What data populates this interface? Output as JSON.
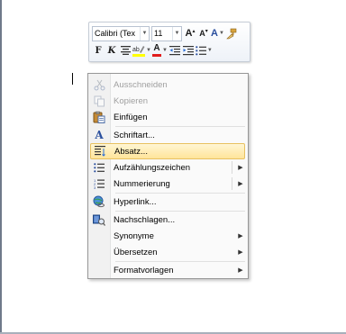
{
  "toolbar": {
    "font_name": "Calibri (Tex",
    "font_size": "11",
    "grow_font": "A",
    "shrink_font": "A",
    "styles": "A",
    "bold": "F",
    "italic": "K",
    "font_color": "A"
  },
  "menu": {
    "cut": "Ausschneiden",
    "copy": "Kopieren",
    "paste": "Einfügen",
    "font": "Schriftart...",
    "paragraph": "Absatz...",
    "bullets": "Aufzählungszeichen",
    "numbering": "Nummerierung",
    "hyperlink": "Hyperlink...",
    "lookup": "Nachschlagen...",
    "synonyms": "Synonyme",
    "translate": "Übersetzen",
    "styles": "Formatvorlagen"
  },
  "colors": {
    "highlight_fill": "#ffe49a",
    "highlight_border": "#e8c160",
    "font_color_bar": "#e11d1d",
    "highlighter_bar": "#ffff00"
  }
}
